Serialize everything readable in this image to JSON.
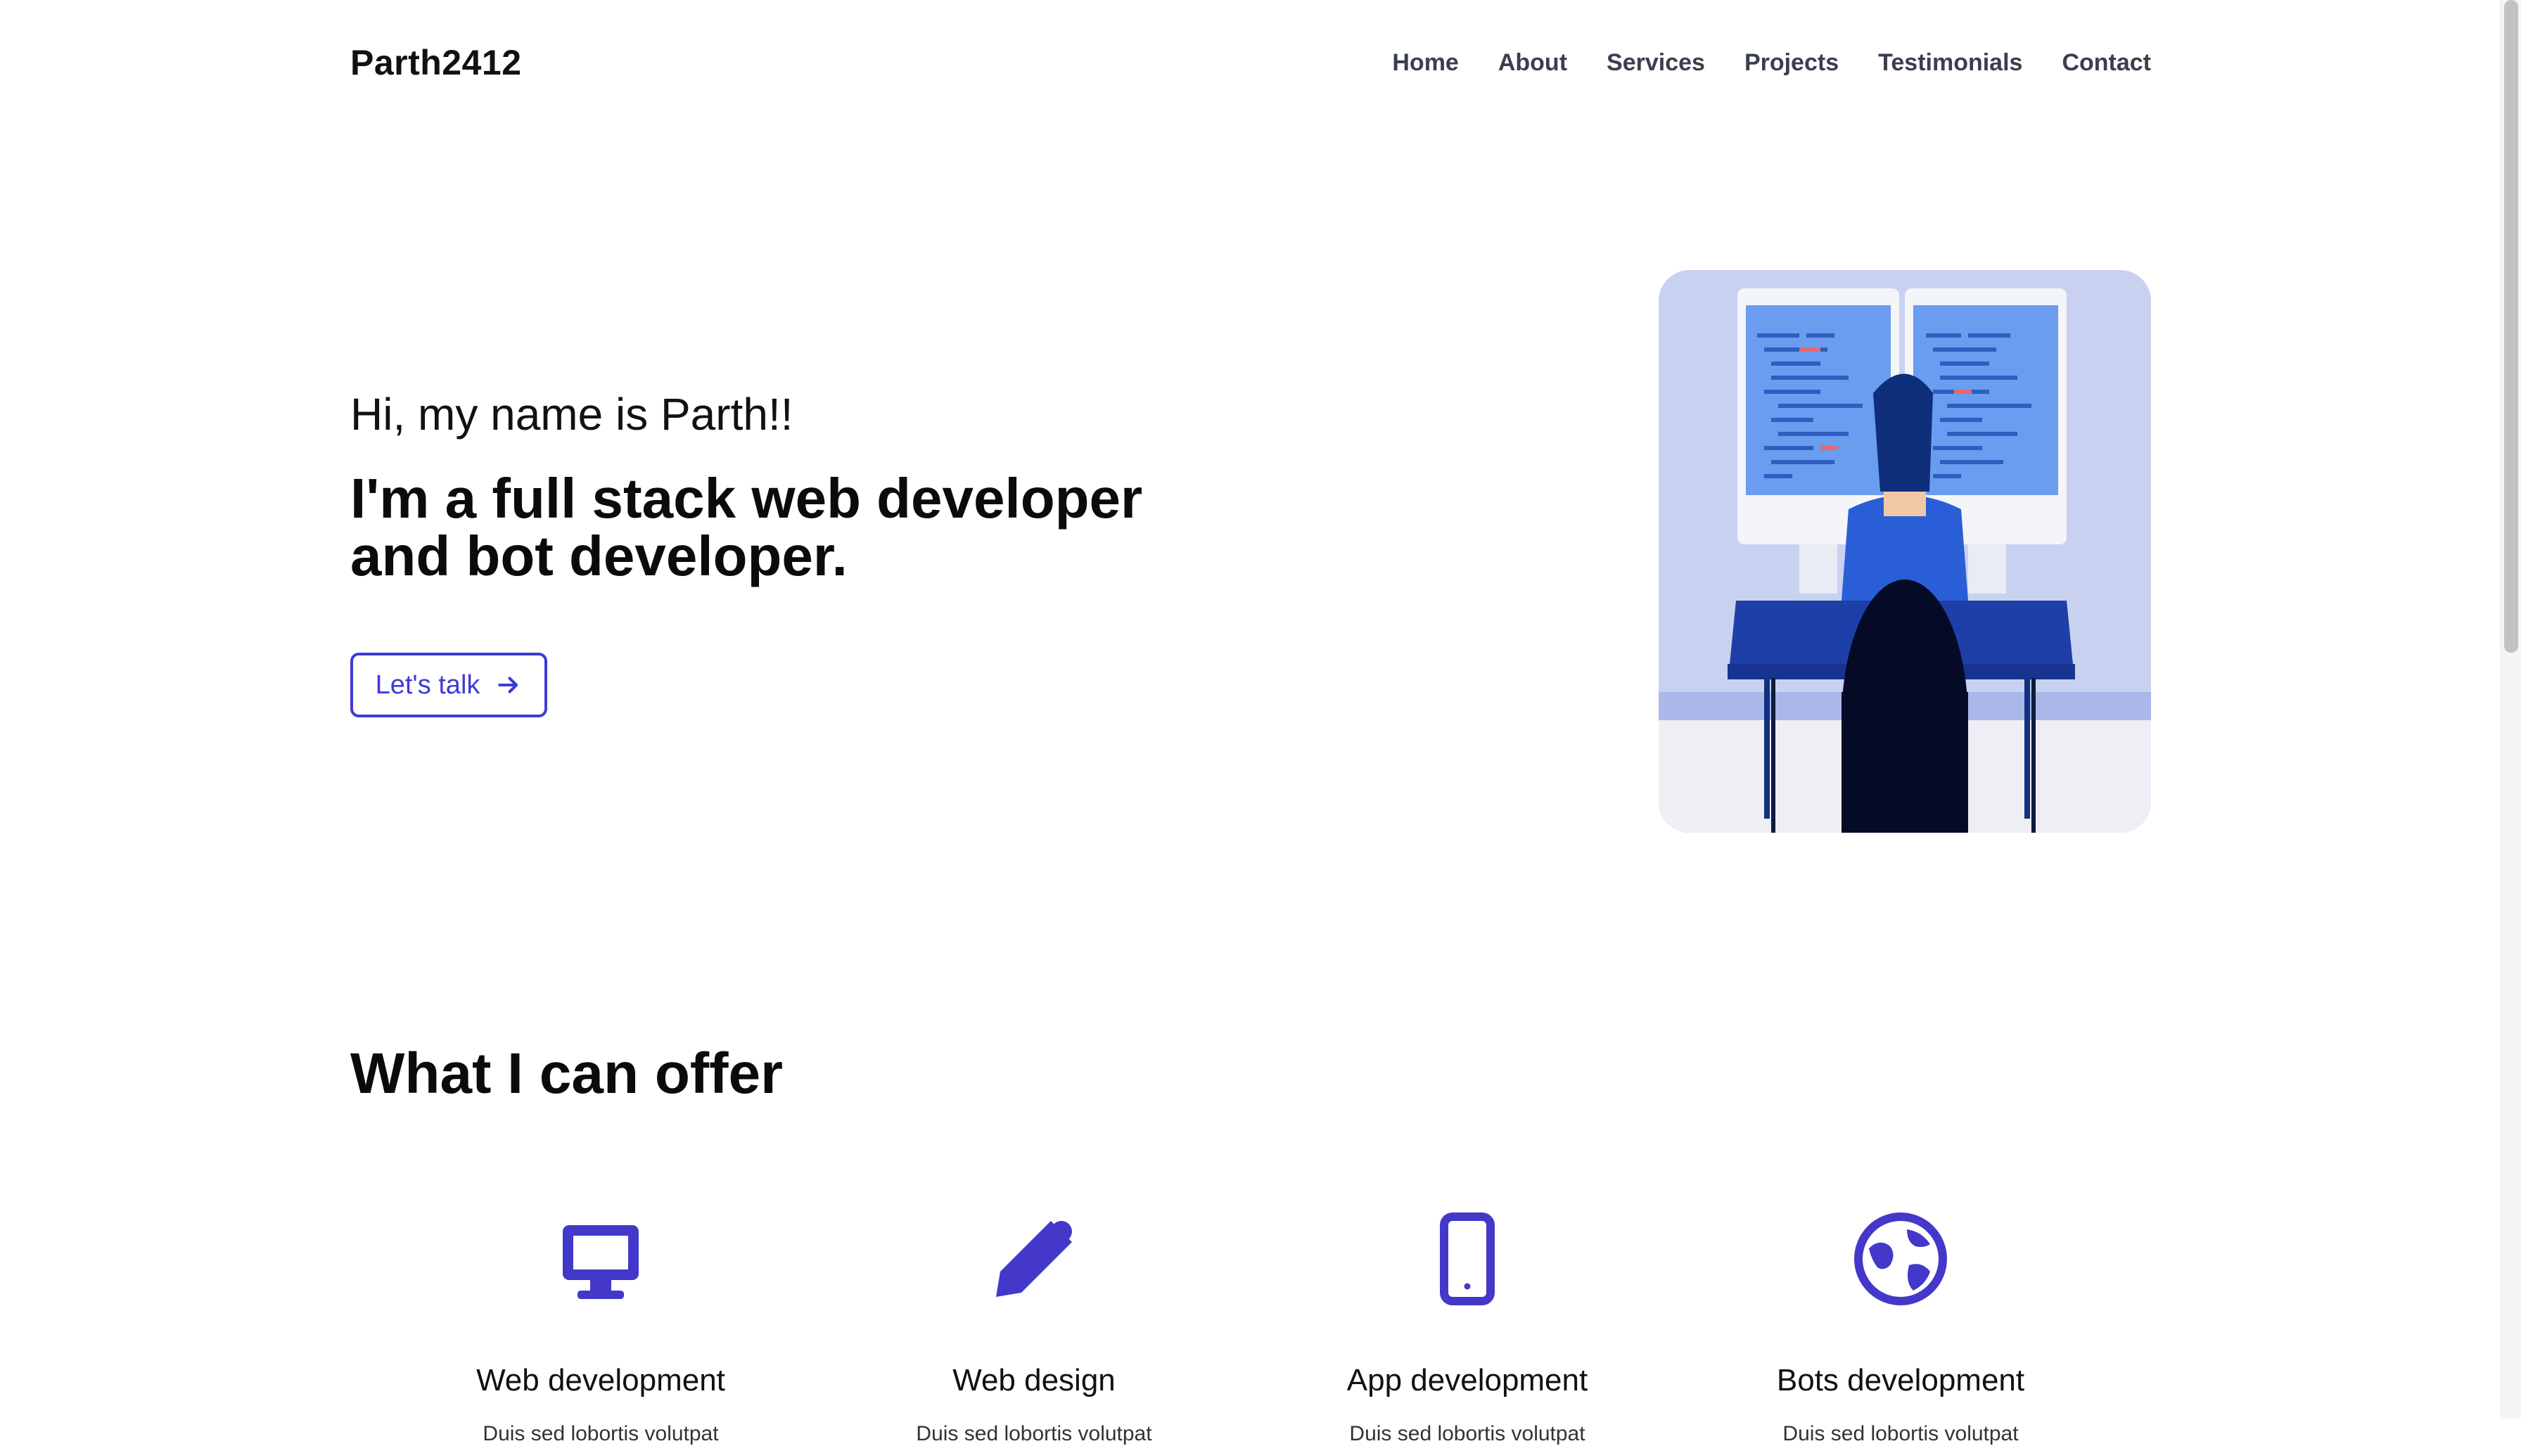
{
  "header": {
    "logo": "Parth2412",
    "nav": [
      "Home",
      "About",
      "Services",
      "Projects",
      "Testimonials",
      "Contact"
    ]
  },
  "hero": {
    "greeting": "Hi, my name is Parth!!",
    "title_line1": "I'm a full stack web developer",
    "title_line2": "and bot developer.",
    "cta_label": "Let's talk",
    "image_alt": "Developer sitting at desk with two monitors"
  },
  "services": {
    "title": "What I can offer",
    "items": [
      {
        "name": "Web development",
        "icon": "desktop-icon",
        "desc": "Duis sed lobortis volutpat"
      },
      {
        "name": "Web design",
        "icon": "pencil-icon",
        "desc": "Duis sed lobortis volutpat"
      },
      {
        "name": "App development",
        "icon": "mobile-icon",
        "desc": "Duis sed lobortis volutpat"
      },
      {
        "name": "Bots development",
        "icon": "globe-icon",
        "desc": "Duis sed lobortis volutpat"
      }
    ]
  },
  "colors": {
    "accent": "#4338ca",
    "text": "#111111",
    "nav": "#3a3f4d"
  }
}
